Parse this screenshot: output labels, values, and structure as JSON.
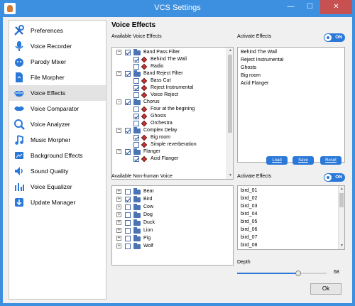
{
  "window": {
    "title": "VCS Settings",
    "minimize": "—",
    "maximize": "☐",
    "close": "✕"
  },
  "sidebar": {
    "items": [
      {
        "label": "Preferences",
        "icon": "wrench-icon"
      },
      {
        "label": "Voice Recorder",
        "icon": "microphone-icon"
      },
      {
        "label": "Parody Mixer",
        "icon": "face-icon"
      },
      {
        "label": "File Morpher",
        "icon": "file-icon"
      },
      {
        "label": "Voice Effects",
        "icon": "lips-icon",
        "active": true
      },
      {
        "label": "Voice Comparator",
        "icon": "comparator-icon"
      },
      {
        "label": "Voice Analyzer",
        "icon": "magnifier-icon"
      },
      {
        "label": "Music Morpher",
        "icon": "music-note-icon"
      },
      {
        "label": "Background Effects",
        "icon": "background-icon"
      },
      {
        "label": "Sound Quality",
        "icon": "speaker-icon"
      },
      {
        "label": "Voice Equalizer",
        "icon": "equalizer-icon"
      },
      {
        "label": "Update Manager",
        "icon": "update-icon"
      }
    ]
  },
  "main": {
    "title": "Voice Effects",
    "available_effects": {
      "label": "Available Voice Effects",
      "tree": [
        {
          "group": "Band Pass Filter",
          "children": [
            {
              "label": "Behind The Wall",
              "checked": true
            },
            {
              "label": "Radio",
              "checked": false
            }
          ]
        },
        {
          "group": "Band Reject Filter",
          "children": [
            {
              "label": "Bass Cut",
              "checked": false
            },
            {
              "label": "Reject Instrumental",
              "checked": true
            },
            {
              "label": "Voice Reject",
              "checked": false
            }
          ]
        },
        {
          "group": "Chorus",
          "children": [
            {
              "label": "Four at the begining",
              "checked": false
            },
            {
              "label": "Ghosts",
              "checked": true
            },
            {
              "label": "Orchestra",
              "checked": false
            }
          ]
        },
        {
          "group": "Complex Delay",
          "children": [
            {
              "label": "Big room",
              "checked": true
            },
            {
              "label": "Simple reverberation",
              "checked": false
            }
          ]
        },
        {
          "group": "Flanger",
          "children": [
            {
              "label": "Acid Flanger",
              "checked": true
            }
          ]
        }
      ]
    },
    "activate_effects": {
      "label": "Activate Effects",
      "toggle": "ON",
      "items": [
        "Behind The Wall",
        "Reject Instrumental",
        "Ghosts",
        "Big room",
        "Acid Flanger"
      ]
    },
    "buttons": {
      "load": "Load",
      "save": "Save",
      "reset": "Reset"
    },
    "nonhuman": {
      "label": "Available Non-human Voice",
      "items": [
        {
          "label": "Bear",
          "checked": false
        },
        {
          "label": "Bird",
          "checked": true
        },
        {
          "label": "Cow",
          "checked": false
        },
        {
          "label": "Dog",
          "checked": false
        },
        {
          "label": "Duck",
          "checked": false
        },
        {
          "label": "Lion",
          "checked": false
        },
        {
          "label": "Pig",
          "checked": false
        },
        {
          "label": "Wolf",
          "checked": false
        }
      ]
    },
    "activate_nonhuman": {
      "label": "Activate Effects",
      "toggle": "ON",
      "items": [
        "bird_01",
        "bird_02",
        "bird_03",
        "bird_04",
        "bird_05",
        "bird_06",
        "bird_07",
        "bird_08"
      ]
    },
    "depth": {
      "label": "Depth",
      "value": "68",
      "fraction": 0.68
    },
    "ok": "Ok"
  },
  "colors": {
    "accent": "#2a78d8",
    "titlebar": "#3d8fe0",
    "close": "#c75050"
  }
}
